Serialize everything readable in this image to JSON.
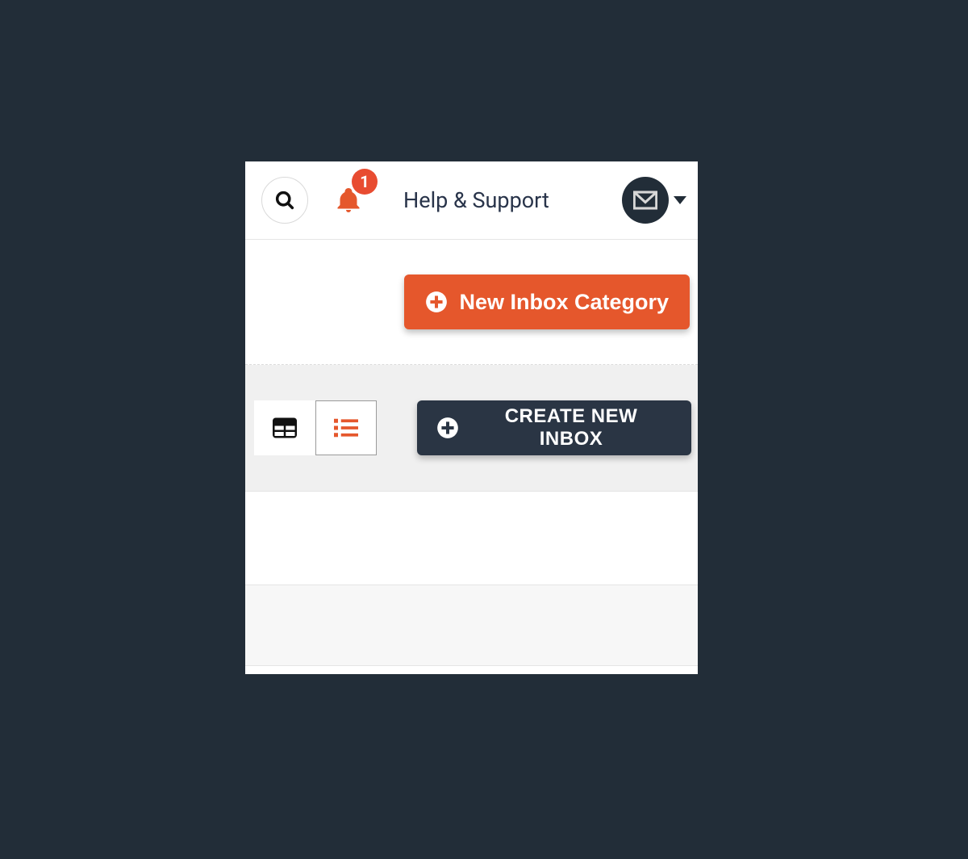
{
  "topbar": {
    "notification_count": "1",
    "help_label": "Help & Support"
  },
  "actions": {
    "new_category_label": "New Inbox Category",
    "create_inbox_label": "CREATE NEW INBOX"
  },
  "colors": {
    "accent_orange": "#e5572c",
    "dark": "#2a3544",
    "badge": "#e84c31"
  }
}
